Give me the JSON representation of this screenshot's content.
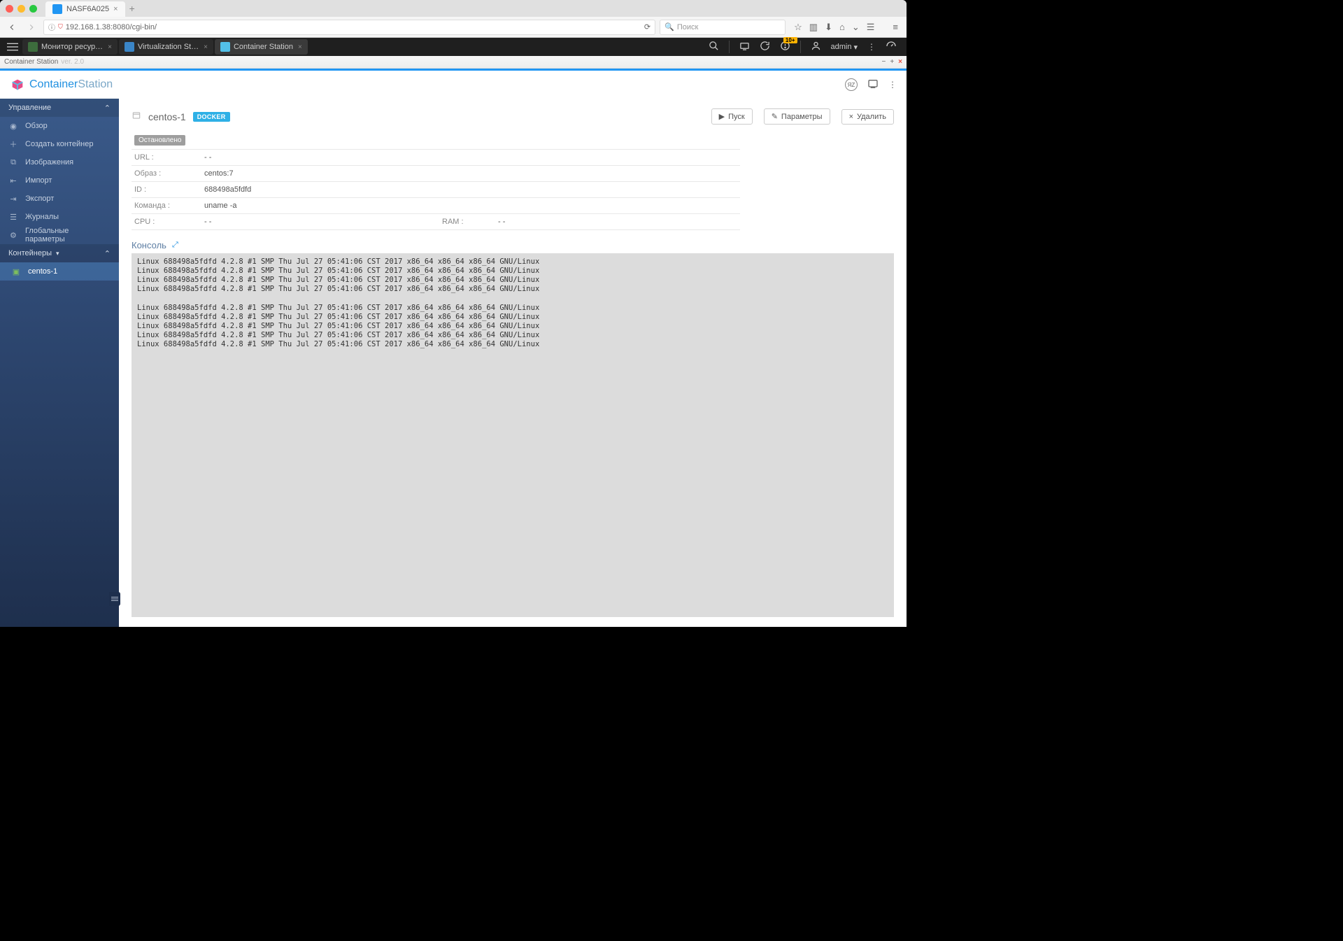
{
  "browser": {
    "tab_title": "NASF6A025",
    "url": "192.168.1.38:8080/cgi-bin/",
    "search_placeholder": "Поиск"
  },
  "qts": {
    "tasks": [
      {
        "label": "Монитор ресур…",
        "color": "#3d6d3d"
      },
      {
        "label": "Virtualization St…",
        "color": "#3a85c7"
      },
      {
        "label": "Container Station",
        "color": "#53c0e8"
      }
    ],
    "info_badge": "10+",
    "user": "admin"
  },
  "app_titlebar": {
    "title": "Container Station",
    "version": "ver. 2.0"
  },
  "cs_header": {
    "brand_a": "Container",
    "brand_b": "Station"
  },
  "sidebar": {
    "section_manage": "Управление",
    "items": [
      {
        "label": "Обзор",
        "icon": "◉"
      },
      {
        "label": "Создать контейнер",
        "icon": "＋"
      },
      {
        "label": "Изображения",
        "icon": "⧉"
      },
      {
        "label": "Импорт",
        "icon": "⇤"
      },
      {
        "label": "Экспорт",
        "icon": "⇥"
      },
      {
        "label": "Журналы",
        "icon": "☰"
      },
      {
        "label": "Глобальные параметры",
        "icon": "⚙"
      }
    ],
    "section_containers": "Контейнеры",
    "container_item": "centos-1"
  },
  "content": {
    "title": "centos-1",
    "docker_badge": "DOCKER",
    "buttons": {
      "start": "Пуск",
      "settings": "Параметры",
      "delete": "Удалить"
    },
    "status": "Остановлено",
    "details": {
      "url_label": "URL :",
      "url_value": "- -",
      "image_label": "Образ :",
      "image_value": "centos:7",
      "id_label": "ID :",
      "id_value": "688498a5fdfd",
      "cmd_label": "Команда :",
      "cmd_value": "uname -a",
      "cpu_label": "CPU :",
      "cpu_value": "- -",
      "ram_label": "RAM :",
      "ram_value": "- -"
    },
    "console_label": "Консоль",
    "console_lines": [
      "Linux 688498a5fdfd 4.2.8 #1 SMP Thu Jul 27 05:41:06 CST 2017 x86_64 x86_64 x86_64 GNU/Linux",
      "Linux 688498a5fdfd 4.2.8 #1 SMP Thu Jul 27 05:41:06 CST 2017 x86_64 x86_64 x86_64 GNU/Linux",
      "Linux 688498a5fdfd 4.2.8 #1 SMP Thu Jul 27 05:41:06 CST 2017 x86_64 x86_64 x86_64 GNU/Linux",
      "Linux 688498a5fdfd 4.2.8 #1 SMP Thu Jul 27 05:41:06 CST 2017 x86_64 x86_64 x86_64 GNU/Linux",
      "",
      "Linux 688498a5fdfd 4.2.8 #1 SMP Thu Jul 27 05:41:06 CST 2017 x86_64 x86_64 x86_64 GNU/Linux",
      "Linux 688498a5fdfd 4.2.8 #1 SMP Thu Jul 27 05:41:06 CST 2017 x86_64 x86_64 x86_64 GNU/Linux",
      "Linux 688498a5fdfd 4.2.8 #1 SMP Thu Jul 27 05:41:06 CST 2017 x86_64 x86_64 x86_64 GNU/Linux",
      "Linux 688498a5fdfd 4.2.8 #1 SMP Thu Jul 27 05:41:06 CST 2017 x86_64 x86_64 x86_64 GNU/Linux",
      "Linux 688498a5fdfd 4.2.8 #1 SMP Thu Jul 27 05:41:06 CST 2017 x86_64 x86_64 x86_64 GNU/Linux"
    ]
  }
}
